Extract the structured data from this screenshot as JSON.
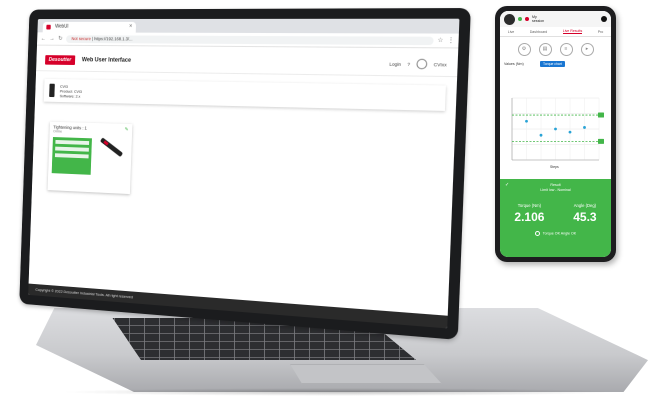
{
  "browser": {
    "tab_title": "WebUI",
    "url_warning": "Not secure",
    "url": "https://192.168.1.3/..."
  },
  "app": {
    "brand": "Desoutter",
    "title": "Web User Interface",
    "header_right": [
      "Login",
      "?",
      "CVIxx"
    ],
    "device_lines": [
      "CVI3",
      "Product: CVI3",
      "Software: 2.x"
    ],
    "tool_card_title": "Tightening units : 1",
    "tool_card_sub": "Online",
    "footer": "Copyright © 2022 Desoutter Industrial Tools. All right reserved"
  },
  "phone": {
    "top_text": [
      "My",
      "session"
    ],
    "tabs": [
      "Live",
      "Dashboard",
      "Live Results",
      "Pro"
    ],
    "active_tab": "Live Results",
    "icons": [
      "wrench-icon",
      "chart-icon",
      "list-icon",
      "video-icon"
    ],
    "chart_label": "Values (Nm)",
    "chart_button": "Torque chart",
    "x_axis_label": "Steps",
    "result_header": [
      "Result",
      "Limit low - Nominal"
    ],
    "torque_label": "Torque (Nm)",
    "angle_label": "Angle (Deg)",
    "status_text": "Torque OK Angle OK",
    "colors": {
      "accent": "#d6002a",
      "ok_green": "#43b649",
      "chart_blue": "#29a3d6"
    }
  },
  "chart_data": {
    "type": "scatter",
    "title": "",
    "xlabel": "Steps",
    "ylabel": "Values (Nm)",
    "xlim": [
      0,
      6
    ],
    "ylim": [
      0,
      4
    ],
    "x": [
      1,
      2,
      3,
      4,
      5
    ],
    "values": [
      2.5,
      1.6,
      2.0,
      1.8,
      2.1
    ],
    "reference_lines": [
      2.9,
      1.2
    ],
    "result": {
      "torque": "2.106",
      "angle": "45.3"
    }
  }
}
